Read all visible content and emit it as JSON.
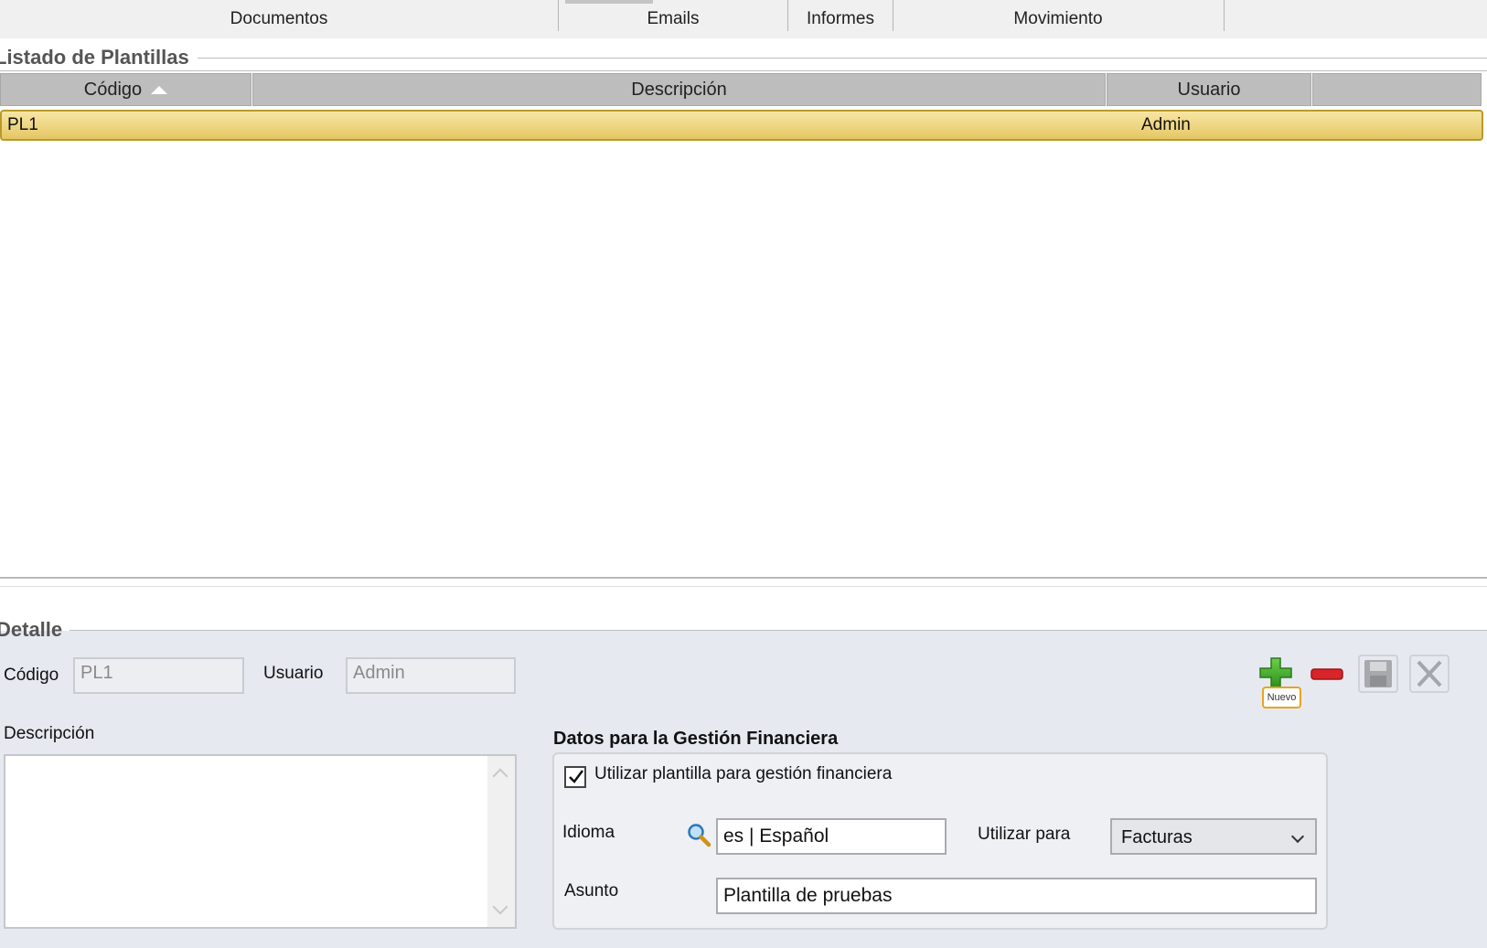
{
  "tabs": [
    {
      "label": "Documentos"
    },
    {
      "label": "Emails"
    },
    {
      "label": "Informes"
    },
    {
      "label": "Movimiento"
    }
  ],
  "list_section": {
    "title": "Listado de Plantillas"
  },
  "grid": {
    "columns": [
      "Código",
      "Descripción",
      "Usuario",
      ""
    ],
    "sort": {
      "column": "Código",
      "direction": "ascending"
    },
    "rows": [
      {
        "codigo": "PL1",
        "descripcion": "",
        "usuario": "Admin",
        "selected": true
      }
    ],
    "selected_color": "#e9cf74"
  },
  "detail": {
    "title": "Detalle",
    "codigo_label": "Código",
    "codigo_value": "PL1",
    "usuario_label": "Usuario",
    "usuario_value": "Admin",
    "descripcion_label": "Descripción",
    "descripcion_value": "",
    "toolbar": {
      "new_icon": "plus-icon",
      "new_tooltip": "Nuevo",
      "delete_icon": "minus-icon",
      "save_icon": "floppy-disk-icon",
      "cancel_icon": "close-icon"
    },
    "financial": {
      "title": "Datos para la Gestión Financiera",
      "use_template_label": "Utilizar plantilla para gestión financiera",
      "use_template_checked": true,
      "idioma_label": "Idioma",
      "idioma_value": "es | Español",
      "utilizar_para_label": "Utilizar para",
      "utilizar_para_value": "Facturas",
      "asunto_label": "Asunto",
      "asunto_value": "Plantilla de pruebas"
    }
  }
}
